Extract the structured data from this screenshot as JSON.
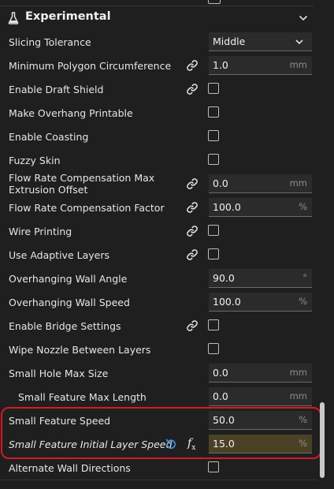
{
  "section": {
    "title": "Experimental",
    "icon": "flask-icon",
    "chevron": "chevron-down-icon"
  },
  "rows": [
    {
      "label": "Slicing Tolerance",
      "kind": "select",
      "value": "Middle"
    },
    {
      "label": "Minimum Polygon Circumference",
      "kind": "field",
      "value": "1.0",
      "unit": "mm",
      "linked": true
    },
    {
      "label": "Enable Draft Shield",
      "kind": "checkbox",
      "checked": false,
      "linked": true
    },
    {
      "label": "Make Overhang Printable",
      "kind": "checkbox",
      "checked": false
    },
    {
      "label": "Enable Coasting",
      "kind": "checkbox",
      "checked": false
    },
    {
      "label": "Fuzzy Skin",
      "kind": "checkbox",
      "checked": false
    },
    {
      "label": "Flow Rate Compensation Max Extrusion Offset",
      "kind": "field",
      "value": "0.0",
      "unit": "mm",
      "linked": true
    },
    {
      "label": "Flow Rate Compensation Factor",
      "kind": "field",
      "value": "100.0",
      "unit": "%",
      "linked": true
    },
    {
      "label": "Wire Printing",
      "kind": "checkbox",
      "checked": false,
      "linked": true
    },
    {
      "label": "Use Adaptive Layers",
      "kind": "checkbox",
      "checked": false,
      "linked": true
    },
    {
      "label": "Overhanging Wall Angle",
      "kind": "field",
      "value": "90.0",
      "unit": "°"
    },
    {
      "label": "Overhanging Wall Speed",
      "kind": "field",
      "value": "100.0",
      "unit": "%"
    },
    {
      "label": "Enable Bridge Settings",
      "kind": "checkbox",
      "checked": false,
      "linked": true
    },
    {
      "label": "Wipe Nozzle Between Layers",
      "kind": "checkbox",
      "checked": false
    },
    {
      "label": "Small Hole Max Size",
      "kind": "field",
      "value": "0.0",
      "unit": "mm"
    },
    {
      "label": "Small Feature Max Length",
      "kind": "field",
      "value": "0.0",
      "unit": "mm"
    },
    {
      "label": "Small Feature Speed",
      "kind": "field",
      "value": "50.0",
      "unit": "%"
    },
    {
      "label": "Small Feature Initial Layer Speed",
      "kind": "field",
      "value": "15.0",
      "unit": "%",
      "modified": true
    },
    {
      "label": "Alternate Wall Directions",
      "kind": "checkbox",
      "checked": false
    }
  ],
  "colors": {
    "background": "#1f1f1f",
    "highlight_border": "#d31a24",
    "modified_field": "#4b4226",
    "reset_icon": "#3d8fe6"
  }
}
